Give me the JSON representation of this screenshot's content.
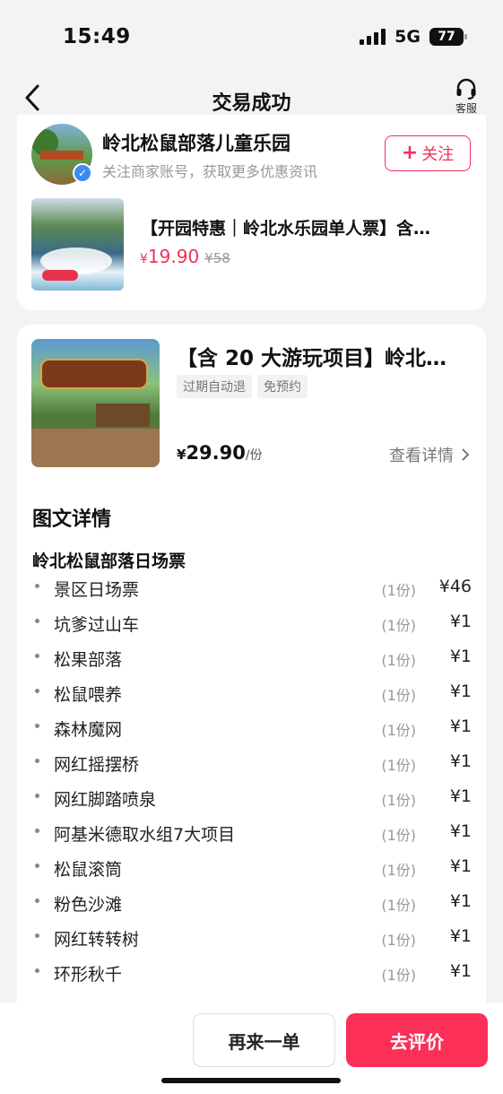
{
  "status_bar": {
    "time": "15:49",
    "network": "5G",
    "battery": "77"
  },
  "nav": {
    "title": "交易成功",
    "service_label": "客服"
  },
  "merchant": {
    "name": "岭北松鼠部落儿童乐园",
    "subtitle": "关注商家账号，获取更多优惠资讯",
    "follow_label": "关注"
  },
  "promo": {
    "title": "【开园特惠｜岭北水乐园单人票】含…",
    "price_symbol": "¥",
    "price": "19.90",
    "original_price": "¥58"
  },
  "order": {
    "title": "【含 20 大游玩项目】岭北…",
    "tags": [
      "过期自动退",
      "免预约"
    ],
    "price_symbol": "¥",
    "price": "29.90",
    "unit": "/份",
    "view_details": "查看详情"
  },
  "details": {
    "heading": "图文详情",
    "group_title": "岭北松鼠部落日场票",
    "items": [
      {
        "name": "景区日场票",
        "qty": "(1份)",
        "price": "¥46"
      },
      {
        "name": "坑爹过山车",
        "qty": "(1份)",
        "price": "¥1"
      },
      {
        "name": "松果部落",
        "qty": "(1份)",
        "price": "¥1"
      },
      {
        "name": "松鼠喂养",
        "qty": "(1份)",
        "price": "¥1"
      },
      {
        "name": "森林魔网",
        "qty": "(1份)",
        "price": "¥1"
      },
      {
        "name": "网红摇摆桥",
        "qty": "(1份)",
        "price": "¥1"
      },
      {
        "name": "网红脚踏喷泉",
        "qty": "(1份)",
        "price": "¥1"
      },
      {
        "name": "阿基米德取水组7大项目",
        "qty": "(1份)",
        "price": "¥1"
      },
      {
        "name": "松鼠滚筒",
        "qty": "(1份)",
        "price": "¥1"
      },
      {
        "name": "粉色沙滩",
        "qty": "(1份)",
        "price": "¥1"
      },
      {
        "name": "网红转转树",
        "qty": "(1份)",
        "price": "¥1"
      },
      {
        "name": "环形秋千",
        "qty": "(1份)",
        "price": "¥1"
      }
    ]
  },
  "bottom": {
    "reorder_label": "再来一单",
    "review_label": "去评价"
  },
  "colors": {
    "accent": "#f2305a",
    "primary_button": "#fb2f57",
    "background": "#f3f3f5"
  }
}
